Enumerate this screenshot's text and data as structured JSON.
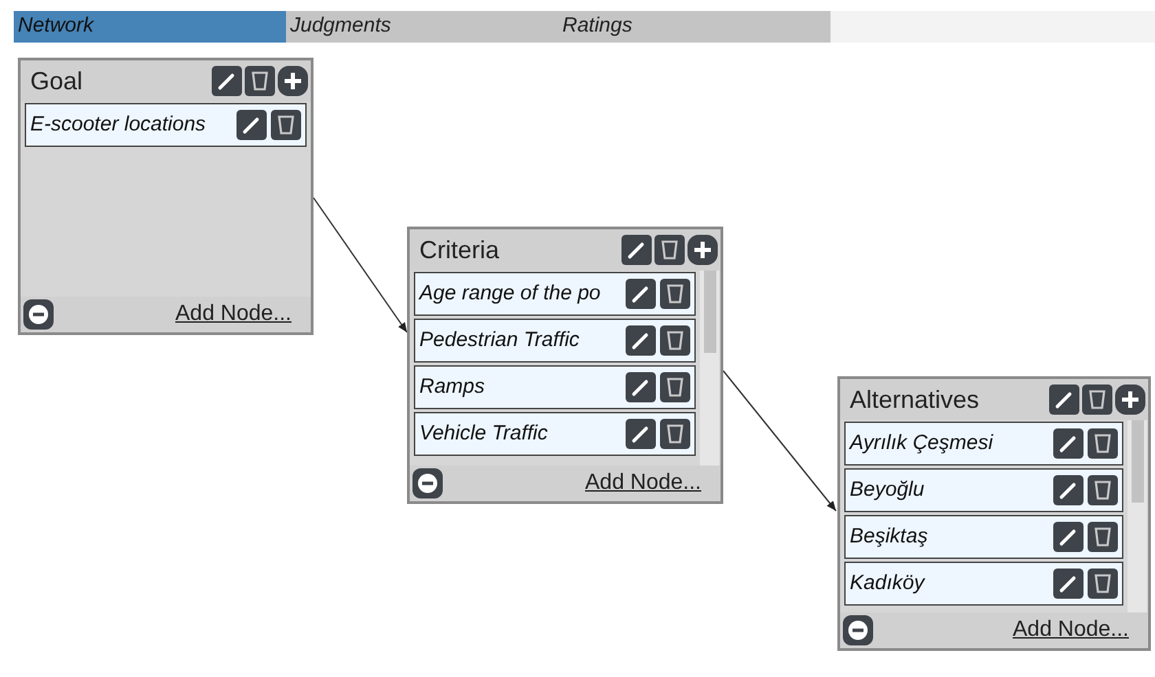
{
  "tabs": [
    {
      "label": "Network",
      "selected": true
    },
    {
      "label": "Judgments",
      "selected": false
    },
    {
      "label": "Ratings",
      "selected": false
    }
  ],
  "nodes": [
    {
      "title": "Goal",
      "items": [
        "E-scooter locations"
      ],
      "add_label": "Add Node..."
    },
    {
      "title": "Criteria",
      "items": [
        "Age range of the po",
        "Pedestrian Traffic",
        "Ramps",
        "Vehicle Traffic"
      ],
      "add_label": "Add Node..."
    },
    {
      "title": "Alternatives",
      "items": [
        "Ayrılık Çeşmesi",
        "Beyoğlu",
        "Beşiktaş",
        "Kadıköy"
      ],
      "add_label": "Add Node..."
    }
  ]
}
